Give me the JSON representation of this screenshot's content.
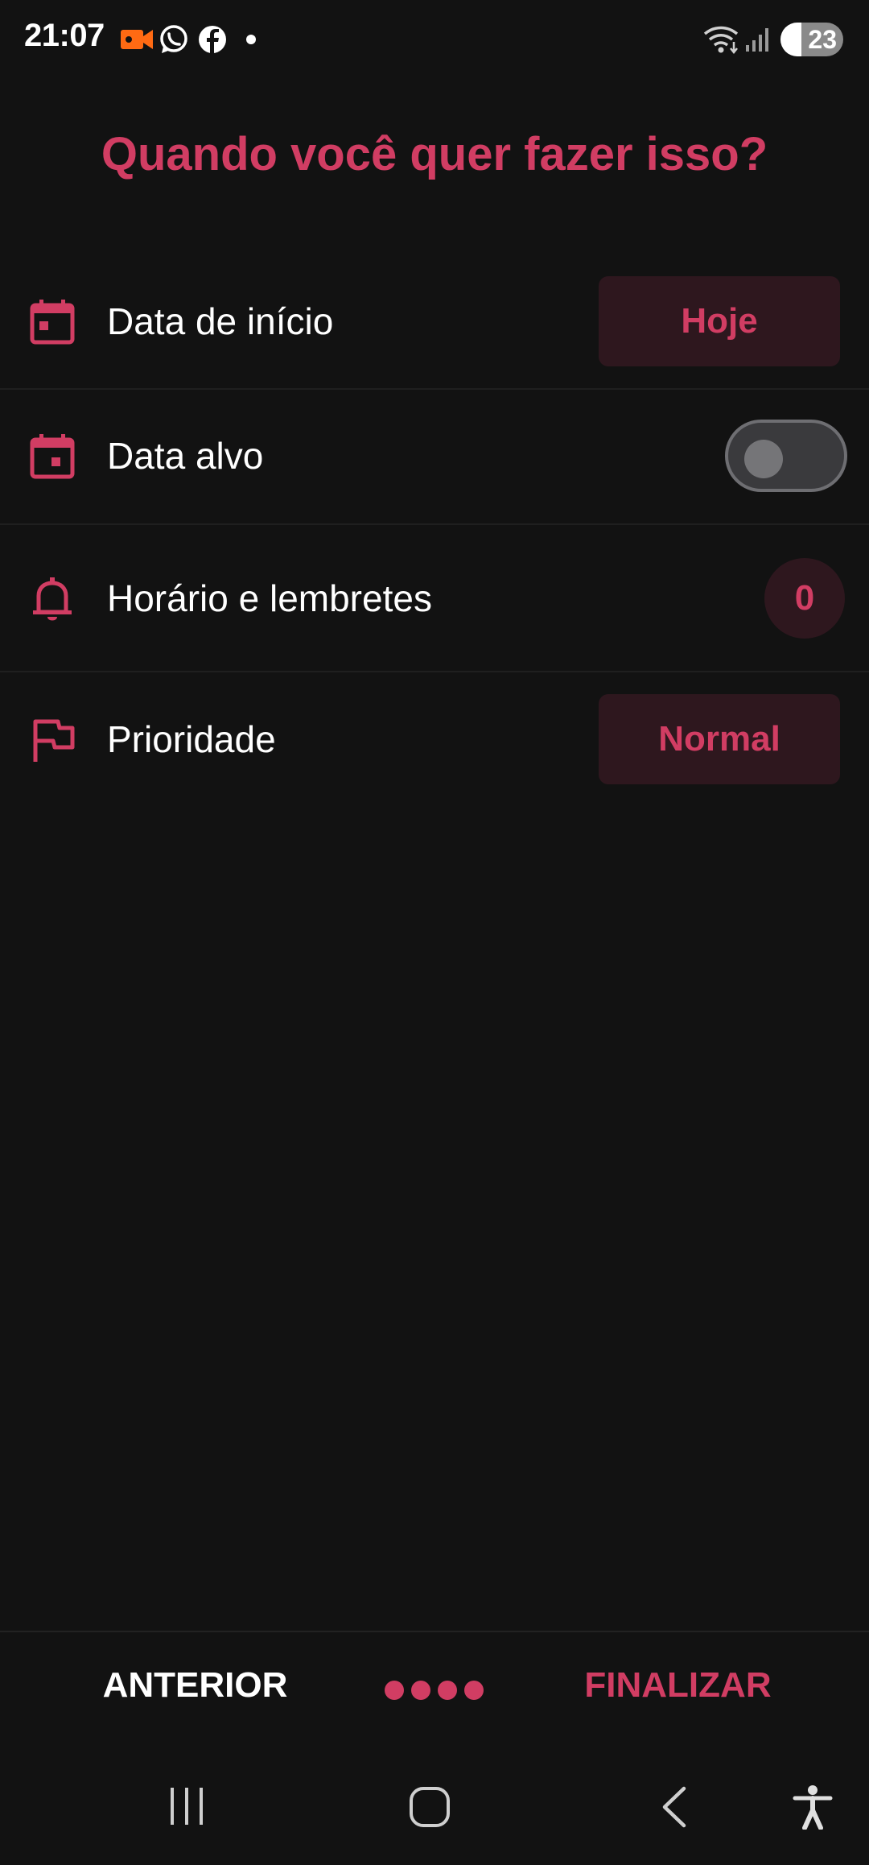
{
  "status_bar": {
    "time": "21:07",
    "battery": "23",
    "icons": [
      "video-recording-icon",
      "whatsapp-icon",
      "facebook-icon",
      "notification-dot-icon",
      "wifi-icon",
      "signal-icon",
      "battery-icon"
    ],
    "video_icon_color": "#ff6a13"
  },
  "page": {
    "title": "Quando você quer fazer isso?"
  },
  "rows": {
    "start_date": {
      "label": "Data de início",
      "value": "Hoje",
      "icon": "calendar-icon"
    },
    "target_date": {
      "label": "Data alvo",
      "toggle_on": false,
      "icon": "calendar-icon"
    },
    "reminders": {
      "label": "Horário e lembretes",
      "count": "0",
      "icon": "bell-icon"
    },
    "priority": {
      "label": "Prioridade",
      "value": "Normal",
      "icon": "flag-icon"
    }
  },
  "footer": {
    "previous_label": "ANTERIOR",
    "finish_label": "FINALIZAR",
    "step_dots": 4
  },
  "navigation": {
    "buttons": [
      "recent-apps",
      "home",
      "back",
      "accessibility"
    ]
  },
  "colors": {
    "accent": "#d13d63",
    "background": "#121212",
    "pill_background": "#2e171e",
    "text": "#ffffff"
  }
}
